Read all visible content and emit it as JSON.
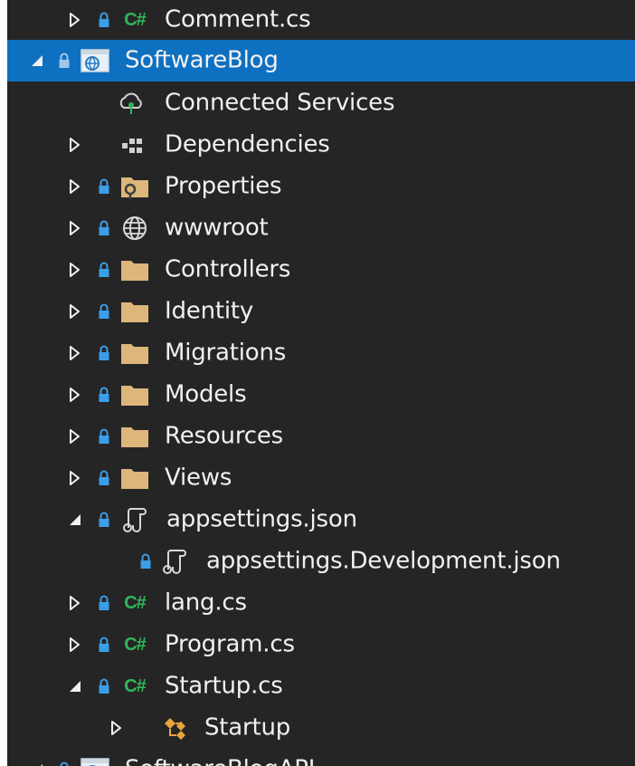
{
  "colors": {
    "background": "#252526",
    "selection": "#0e70c0",
    "text": "#f1f1f1",
    "lock": "#3b9ee8",
    "folder": "#dcb67a",
    "csharp": "#2fb85a"
  },
  "tree": {
    "items": [
      {
        "label": "Comment.cs",
        "icon": "csharp-file-icon",
        "expander": "collapsed"
      },
      {
        "label": "SoftwareBlog",
        "icon": "web-project-icon",
        "expander": "expanded",
        "selected": true
      },
      {
        "label": "Connected Services",
        "icon": "connected-services-icon",
        "expander": "none"
      },
      {
        "label": "Dependencies",
        "icon": "dependencies-icon",
        "expander": "collapsed"
      },
      {
        "label": "Properties",
        "icon": "properties-folder-icon",
        "expander": "collapsed"
      },
      {
        "label": "wwwroot",
        "icon": "globe-icon",
        "expander": "collapsed"
      },
      {
        "label": "Controllers",
        "icon": "folder-icon",
        "expander": "collapsed"
      },
      {
        "label": "Identity",
        "icon": "folder-icon",
        "expander": "collapsed"
      },
      {
        "label": "Migrations",
        "icon": "folder-icon",
        "expander": "collapsed"
      },
      {
        "label": "Models",
        "icon": "folder-icon",
        "expander": "collapsed"
      },
      {
        "label": "Resources",
        "icon": "folder-icon",
        "expander": "collapsed"
      },
      {
        "label": "Views",
        "icon": "folder-icon",
        "expander": "collapsed"
      },
      {
        "label": "appsettings.json",
        "icon": "json-file-icon",
        "expander": "expanded"
      },
      {
        "label": "appsettings.Development.json",
        "icon": "json-file-icon",
        "expander": "none"
      },
      {
        "label": "lang.cs",
        "icon": "csharp-file-icon",
        "expander": "collapsed"
      },
      {
        "label": "Program.cs",
        "icon": "csharp-file-icon",
        "expander": "collapsed"
      },
      {
        "label": "Startup.cs",
        "icon": "csharp-file-icon",
        "expander": "expanded"
      },
      {
        "label": "Startup",
        "icon": "class-icon",
        "expander": "collapsed"
      },
      {
        "label": "SoftwareBlogAPI",
        "icon": "web-project-icon",
        "expander": "expanded"
      }
    ]
  }
}
